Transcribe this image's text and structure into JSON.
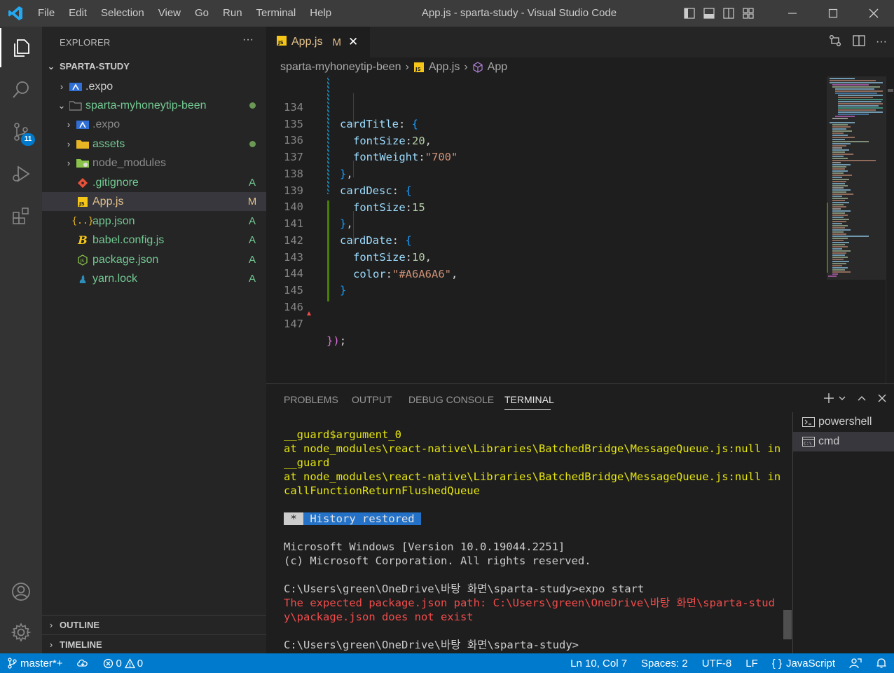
{
  "window": {
    "title": "App.js - sparta-study - Visual Studio Code",
    "menu": [
      "File",
      "Edit",
      "Selection",
      "View",
      "Go",
      "Run",
      "Terminal",
      "Help"
    ]
  },
  "activity": {
    "source_control_badge": "11"
  },
  "sidebar": {
    "header": "EXPLORER",
    "more": "···",
    "root": "SPARTA-STUDY",
    "items": [
      {
        "label": ".expo",
        "status": ""
      },
      {
        "label": "sparta-myhoneytip-been",
        "status": "dot"
      },
      {
        "label": ".expo",
        "status": ""
      },
      {
        "label": "assets",
        "status": "dot"
      },
      {
        "label": "node_modules",
        "status": ""
      },
      {
        "label": ".gitignore",
        "status": "A"
      },
      {
        "label": "App.js",
        "status": "M"
      },
      {
        "label": "app.json",
        "status": "A"
      },
      {
        "label": "babel.config.js",
        "status": "A"
      },
      {
        "label": "package.json",
        "status": "A"
      },
      {
        "label": "yarn.lock",
        "status": "A"
      }
    ],
    "outline": "OUTLINE",
    "timeline": "TIMELINE"
  },
  "editor": {
    "tab": {
      "label": "App.js",
      "modified": "M",
      "close": "✕"
    },
    "breadcrumb": [
      "sparta-myhoneytip-been",
      "App.js",
      "App"
    ],
    "line_numbers": [
      "134",
      "135",
      "136",
      "137",
      "138",
      "139",
      "140",
      "141",
      "142",
      "143",
      "144",
      "145",
      "146",
      "147"
    ],
    "lines": {
      "l134_key": "cardTitle",
      "l134_rest": ": ",
      "l134_br": "{",
      "l135_key": "fontSize",
      "l135_colon": ":",
      "l135_val": "20",
      "l135_end": ",",
      "l136_key": "fontWeight",
      "l136_colon": ":",
      "l136_val": "\"700\"",
      "l137_br": "}",
      "l137_end": ",",
      "l138_key": "cardDesc",
      "l138_rest": ": ",
      "l138_br": "{",
      "l139_key": "fontSize",
      "l139_colon": ":",
      "l139_val": "15",
      "l140_br": "}",
      "l140_end": ",",
      "l141_key": "cardDate",
      "l141_rest": ": ",
      "l141_br": "{",
      "l142_key": "fontSize",
      "l142_colon": ":",
      "l142_val": "10",
      "l142_end": ",",
      "l143_key": "color",
      "l143_colon": ":",
      "l143_val": "\"#A6A6A6\"",
      "l143_end": ",",
      "l144_br": "}",
      "l147_br1": "}",
      "l147_br2": ")",
      "l147_end": ";"
    }
  },
  "panel": {
    "tabs": [
      "PROBLEMS",
      "OUTPUT",
      "DEBUG CONSOLE",
      "TERMINAL"
    ],
    "active_tab": "TERMINAL",
    "terminal_lines": {
      "y1": "__guard$argument_0",
      "y2": "at node_modules\\react-native\\Libraries\\BatchedBridge\\MessageQueue.js:null in",
      "y3": "__guard",
      "y4": "at node_modules\\react-native\\Libraries\\BatchedBridge\\MessageQueue.js:null in",
      "y5": "callFunctionReturnFlushedQueue",
      "hist_star": " * ",
      "hist_text": " History restored ",
      "w1": "Microsoft Windows [Version 10.0.19044.2251]",
      "w2": "(c) Microsoft Corporation. All rights reserved.",
      "w3": "C:\\Users\\green\\OneDrive\\바탕 화면\\sparta-study>expo start",
      "r1": "The expected package.json path: C:\\Users\\green\\OneDrive\\바탕 화면\\sparta-stud",
      "r2": "y\\package.json does not exist",
      "w4": "C:\\Users\\green\\OneDrive\\바탕 화면\\sparta-study>"
    },
    "terminals": [
      "powershell",
      "cmd"
    ]
  },
  "statusbar": {
    "branch": "master*+",
    "errors": "0",
    "warnings": "0",
    "position": "Ln 10, Col 7",
    "spaces": "Spaces: 2",
    "encoding": "UTF-8",
    "eol": "LF",
    "language": "JavaScript"
  },
  "colors": {
    "accent": "#007acc",
    "modified": "#e2c08d",
    "added": "#73c991"
  }
}
